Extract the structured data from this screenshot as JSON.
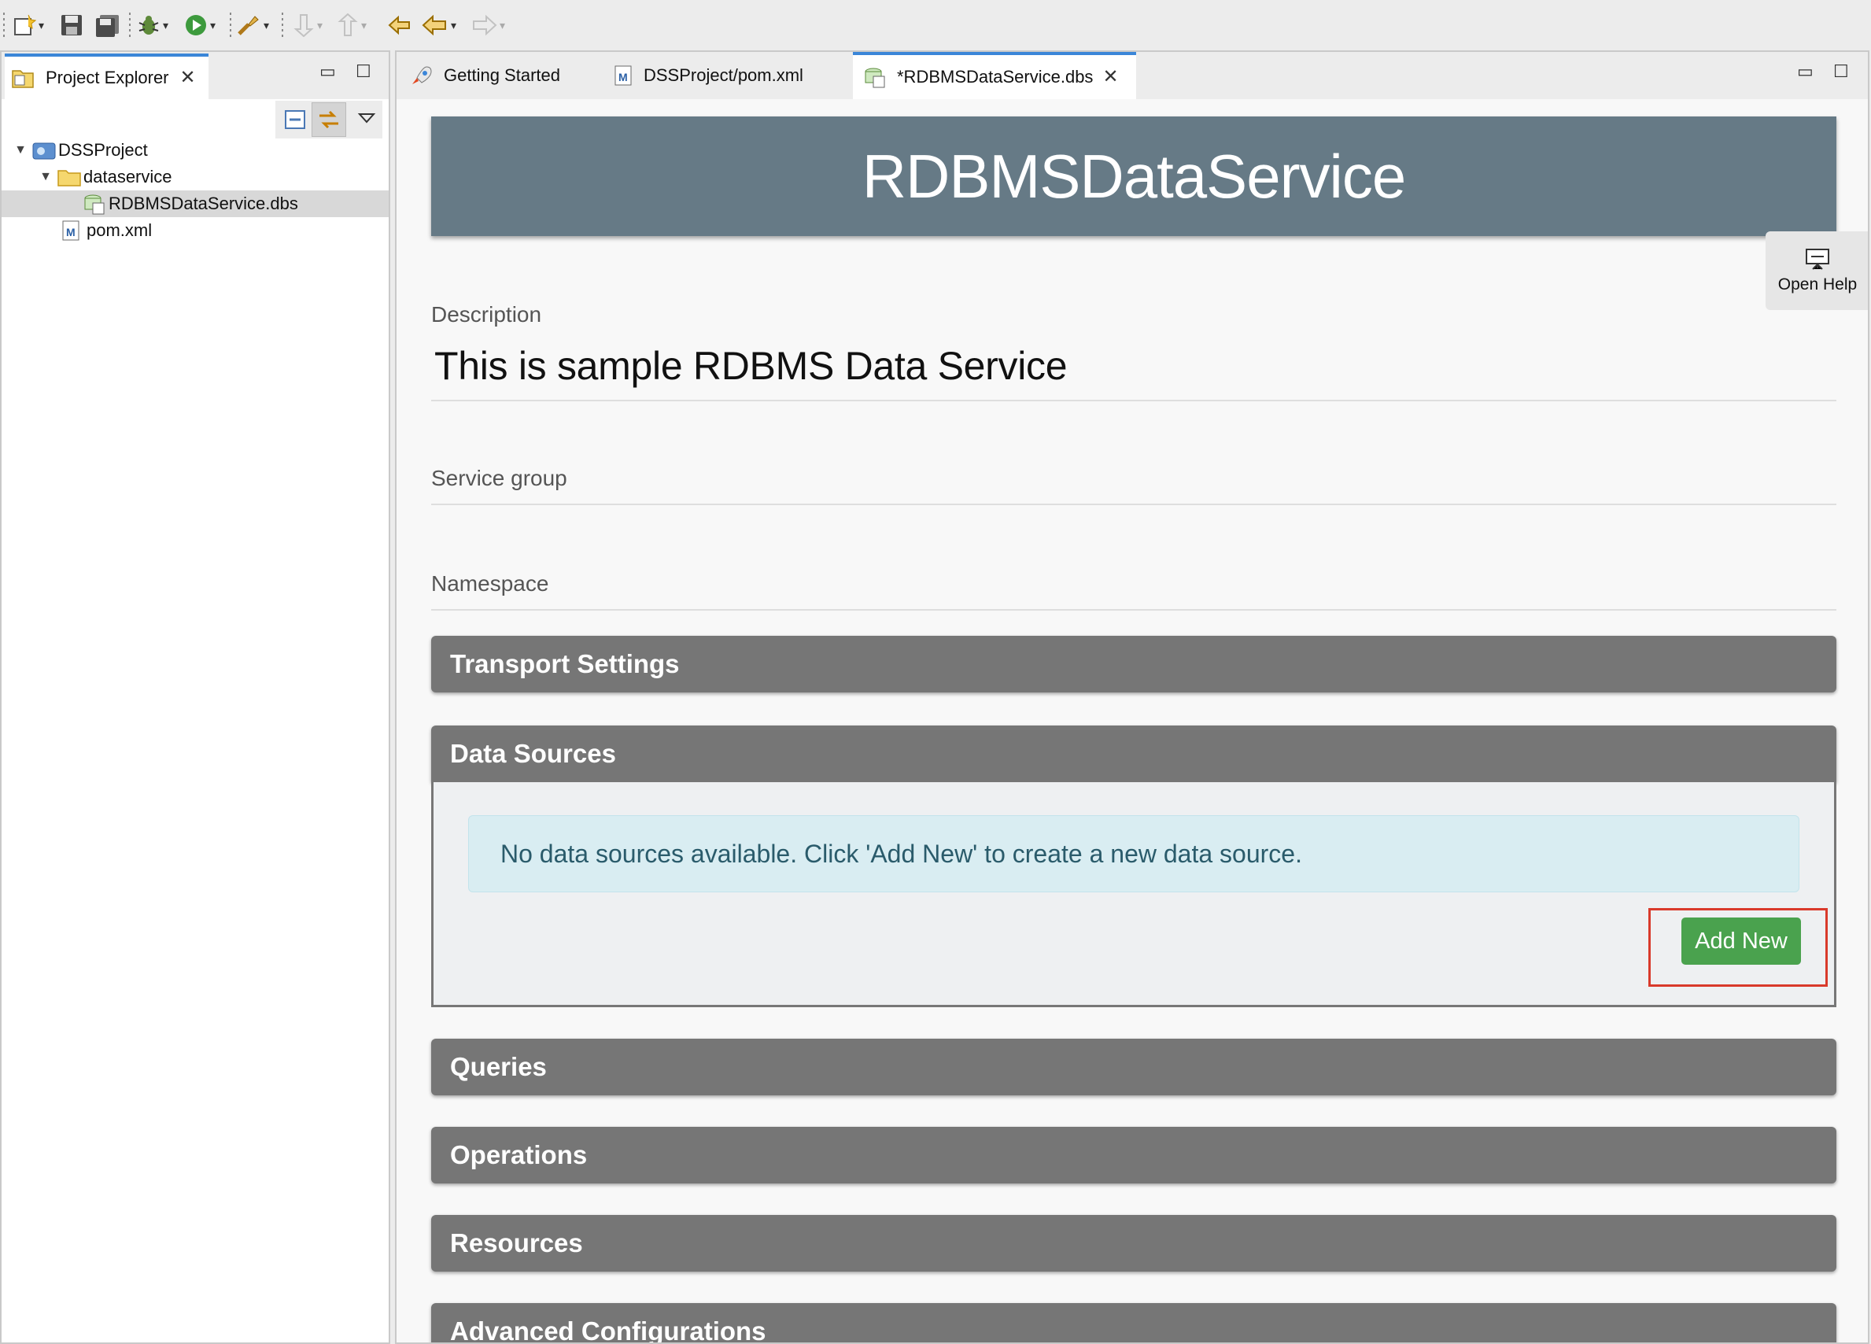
{
  "left_panel": {
    "tab_label": "Project Explorer",
    "tree": [
      {
        "label": "DSSProject"
      },
      {
        "label": "dataservice"
      },
      {
        "label": "RDBMSDataService.dbs"
      },
      {
        "label": "pom.xml"
      }
    ]
  },
  "editor": {
    "tabs": [
      {
        "label": "Getting Started"
      },
      {
        "label": "DSSProject/pom.xml"
      },
      {
        "label": "*RDBMSDataService.dbs"
      }
    ],
    "service_title": "RDBMSDataService",
    "help_label": "Open Help",
    "description_label": "Description",
    "description_value": "This is sample RDBMS Data Service",
    "service_group_label": "Service group",
    "namespace_label": "Namespace",
    "sections": {
      "transport": "Transport Settings",
      "data_sources": "Data Sources",
      "queries": "Queries",
      "operations": "Operations",
      "resources": "Resources",
      "advanced": "Advanced Configurations"
    },
    "data_sources_empty": "No data sources available. Click 'Add New' to create a new data source.",
    "add_new_label": "Add New"
  },
  "colors": {
    "header_bg": "#667a86",
    "section_bg": "#767676",
    "add_button": "#4aa24e",
    "alert_bg": "#d9edf2",
    "highlight": "#d93a2b",
    "active_tab_accent": "#3b86d8"
  }
}
